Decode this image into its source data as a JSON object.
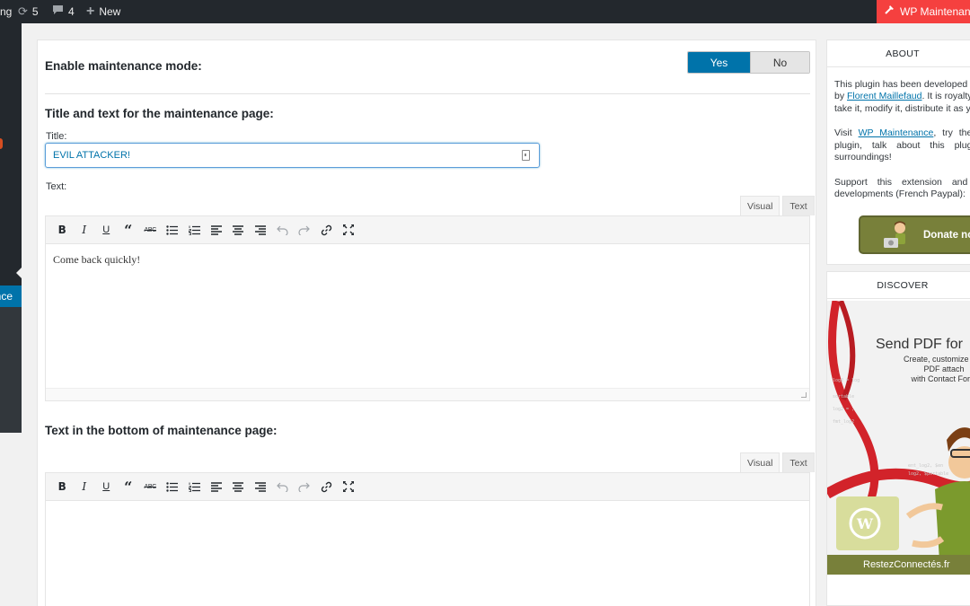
{
  "adminbar": {
    "site_label": "ng",
    "updates_count": "5",
    "comments_count": "4",
    "new_label": "New",
    "maintenance_label": "WP Maintenance",
    "maintenance_color": "#f5403f"
  },
  "sidebar_menu": {
    "current_item_label": "WP Maintenance",
    "accent_color": "#0073aa"
  },
  "settings": {
    "enable_label": "Enable maintenance mode:",
    "toggle": {
      "yes": "Yes",
      "no": "No",
      "selected": "Yes"
    },
    "title_section": "Title and text for the maintenance page:",
    "title_label": "Title:",
    "title_value": "EVIL ATTACKER!",
    "text_label": "Text:",
    "editor1": {
      "tab_visual": "Visual",
      "tab_text": "Text",
      "content": "Come back quickly!"
    },
    "bottom_section": "Text in the bottom of maintenance page:",
    "editor2": {
      "tab_visual": "Visual",
      "tab_text": "Text",
      "content": ""
    },
    "toolbar_icons": [
      "bold-icon",
      "italic-icon",
      "underline-icon",
      "blockquote-icon",
      "strikethrough-icon",
      "bullet-list-icon",
      "numbered-list-icon",
      "align-left-icon",
      "align-center-icon",
      "align-right-icon",
      "undo-icon",
      "redo-icon",
      "link-icon",
      "fullscreen-icon"
    ],
    "toolbar_glyphs": {
      "bold": "B",
      "italic": "I",
      "underline": "U",
      "quote": "“",
      "strike": "ABC"
    }
  },
  "about": {
    "header": "ABOUT",
    "line1": "This plugin has been developed for you",
    "line2_prefix": "by ",
    "author_link": "Florent Maillefaud",
    "line2_suffix": ". It is royalty free,",
    "line3": "take it, modify it, distribute it as you",
    "visit_prefix": "Visit ",
    "visit_link": "WP Maintenance",
    "visit_suffix": ", try the",
    "visit_line2": "plugin, talk about this plugin",
    "visit_line3": "surroundings!",
    "support_line1": "Support this extension and",
    "support_line2": "developments (French Paypal):",
    "donate_label": "Donate now"
  },
  "discover": {
    "header": "DISCOVER",
    "ad_title": "Send PDF for",
    "ad_sub_line1": "Create, customize and",
    "ad_sub_line2": "PDF attach",
    "ad_sub_line3": "with Contact Form",
    "ad_footer": "RestezConnectés.fr"
  }
}
